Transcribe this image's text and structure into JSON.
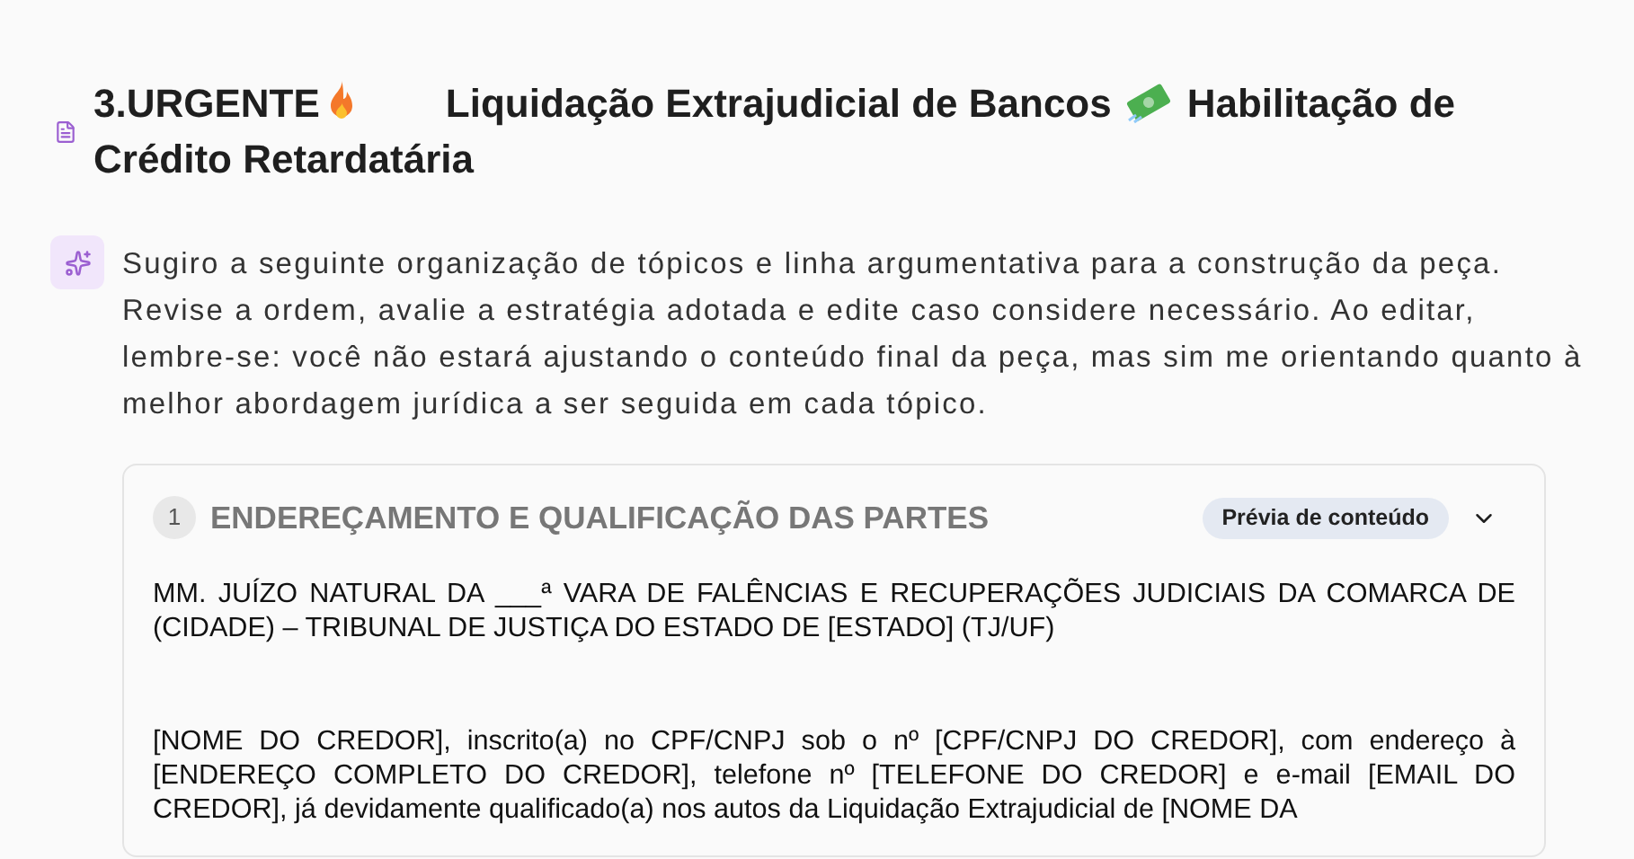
{
  "title": {
    "parts": [
      "3.URGENTE",
      "Liquidação Extrajudicial de Bancos",
      "Habilitação de",
      "Crédito Retardatária"
    ]
  },
  "intro": "Sugiro a seguinte organização de tópicos e linha argumentativa para a construção da peça. Revise a ordem, avalie a estratégia adotada e edite caso considere necessário. Ao editar, lembre-se: você não estará ajustando o conteúdo final da peça, mas sim me orientando quanto à melhor abordagem jurídica a ser seguida em cada tópico.",
  "topics": [
    {
      "number": "1",
      "title": "ENDEREÇAMENTO E QUALIFICAÇÃO DAS PARTES",
      "badge": "Prévia de conteúdo",
      "expanded": true,
      "paragraphs": [
        "MM. JUÍZO NATURAL DA ___ª VARA DE FALÊNCIAS E RECUPERAÇÕES JUDICIAIS DA COMARCA DE (CIDADE) – TRIBUNAL DE JUSTIÇA DO ESTADO DE [ESTADO] (TJ/UF)",
        "[NOME DO CREDOR], inscrito(a) no CPF/CNPJ sob o nº [CPF/CNPJ DO CREDOR], com endereço à [ENDEREÇO COMPLETO DO CREDOR], telefone nº [TELEFONE DO CREDOR] e e-mail [EMAIL DO CREDOR], já devidamente qualificado(a) nos autos da Liquidação Extrajudicial de [NOME DA"
      ]
    }
  ]
}
